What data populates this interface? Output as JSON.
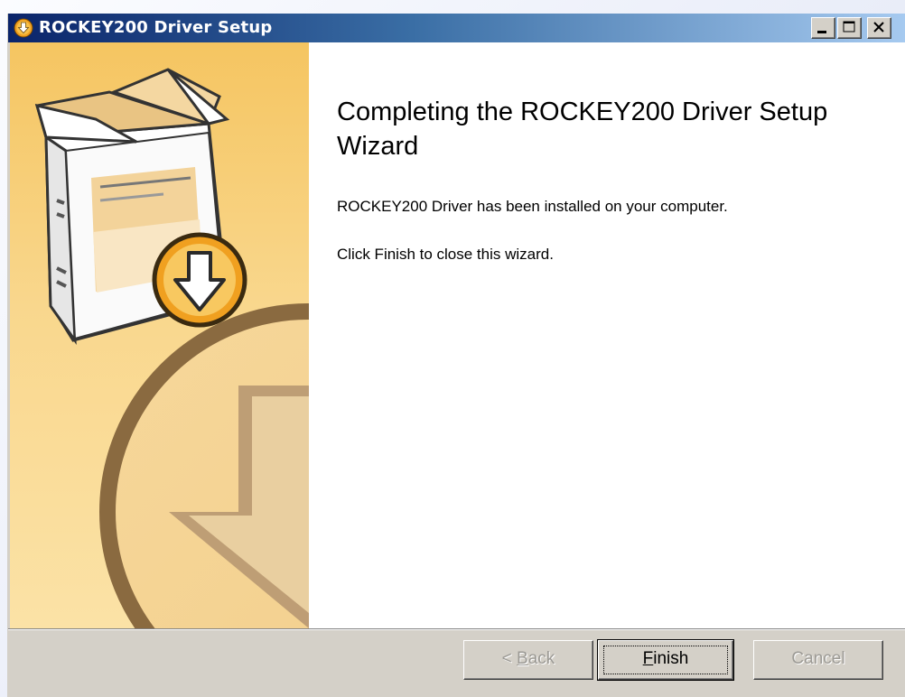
{
  "window": {
    "title": "ROCKEY200 Driver Setup"
  },
  "titlebar_buttons": [
    "minimize",
    "maximize",
    "close"
  ],
  "wizard": {
    "heading": "Completing the ROCKEY200 Driver Setup Wizard",
    "message_installed": "ROCKEY200 Driver has been installed on your computer.",
    "message_finish": "Click Finish to close this wizard."
  },
  "buttons": {
    "back": {
      "prefix": "< ",
      "mnemonic": "B",
      "rest": "ack",
      "enabled": false
    },
    "finish": {
      "prefix": "",
      "mnemonic": "F",
      "rest": "inish",
      "enabled": true
    },
    "cancel": {
      "label": "Cancel",
      "enabled": false
    }
  },
  "icons": {
    "title": "setup-download-icon",
    "sidebar_box": "software-box-icon",
    "sidebar_badge": "download-arrow-badge-icon",
    "sidebar_bg": "large-download-arrow-watermark"
  },
  "colors": {
    "titlebar_start": "#0a246a",
    "titlebar_end": "#a6caf0",
    "sidebar": "#f9d78d",
    "content": "#ffffff",
    "dialog": "#d4d0c8",
    "accent_orange": "#f0a020"
  }
}
